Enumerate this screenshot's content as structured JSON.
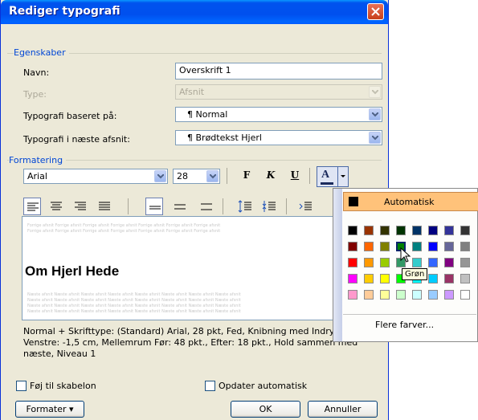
{
  "dialog": {
    "title": "Rediger typografi",
    "properties": {
      "section": "Egenskaber",
      "name_label": "Navn:",
      "name_value": "Overskrift 1",
      "type_label": "Type:",
      "type_value": "Afsnit",
      "based_on_label": "Typografi baseret på:",
      "based_on_value": "¶ Normal",
      "next_label": "Typografi i næste afsnit:",
      "next_value": "¶ Brødtekst Hjerl"
    },
    "formatting": {
      "section": "Formatering",
      "font_value": "Arial",
      "size_value": "28",
      "bold_label": "F",
      "italic_label": "K",
      "underline_label": "U",
      "font_color_label": "A"
    },
    "preview": {
      "ghost_text": "Forrige afsnit Forrige afsnit Forrige afsnit Forrige afsnit Forrige afsnit Forrige afsnit Forrige afsnit",
      "heading": "Om Hjerl Hede",
      "ghost_after": "Næste afsnit Næste afsnit Næste afsnit Næste afsnit Næste afsnit Næste afsnit Næste afsnit Næste afsnit"
    },
    "description": "Normal + Skrifttype: (Standard) Arial, 28 pkt, Fed, Knibning med Indrykning: Venstre: -1,5 cm, Mellemrum Før: 48 pkt., Efter: 18 pkt., Hold sammen med næste, Niveau 1",
    "add_to_template_label": "Føj til skabelon",
    "auto_update_label": "Opdater automatisk",
    "format_button": "Formater ▾",
    "ok_button": "OK",
    "cancel_button": "Annuller"
  },
  "color_popup": {
    "automatic_label": "Automatisk",
    "more_colors_label": "Flere farver...",
    "tooltip": "Grøn",
    "swatches": [
      [
        "#000000",
        "#993300",
        "#333300",
        "#003300",
        "#003366",
        "#000080",
        "#333399",
        "#333333"
      ],
      [
        "#800000",
        "#ff6600",
        "#808000",
        "#008000",
        "#008080",
        "#0000ff",
        "#666699",
        "#808080"
      ],
      [
        "#ff0000",
        "#ff9900",
        "#99cc00",
        "#339966",
        "#33cccc",
        "#3366ff",
        "#800080",
        "#969696"
      ],
      [
        "#ff00ff",
        "#ffcc00",
        "#ffff00",
        "#00ff00",
        "#00ffff",
        "#00ccff",
        "#993366",
        "#c0c0c0"
      ],
      [
        "#ff99cc",
        "#ffcc99",
        "#ffff99",
        "#ccffcc",
        "#ccffff",
        "#99ccff",
        "#cc99ff",
        "#ffffff"
      ]
    ]
  },
  "colors": {
    "title_bar": "#0053ee",
    "accent_label": "#0046d5",
    "automatic_highlight": "#ffc27a"
  }
}
